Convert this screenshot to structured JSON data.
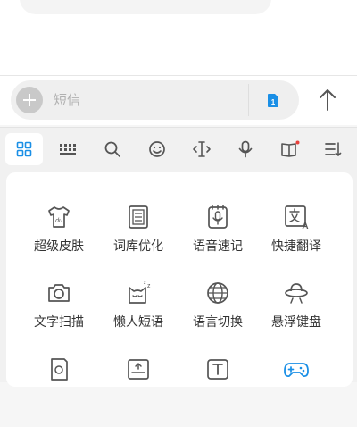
{
  "input_bar": {
    "placeholder": "短信"
  },
  "toolbar": {
    "items": [
      {
        "name": "grid-icon",
        "active": true
      },
      {
        "name": "keyboard-icon",
        "active": false
      },
      {
        "name": "search-icon",
        "active": false
      },
      {
        "name": "emoji-icon",
        "active": false
      },
      {
        "name": "cursor-move-icon",
        "active": false
      },
      {
        "name": "microphone-icon",
        "active": false
      },
      {
        "name": "book-icon",
        "active": false,
        "badge": true
      },
      {
        "name": "menu-icon",
        "active": false
      }
    ]
  },
  "tools": [
    {
      "label": "超级皮肤",
      "icon": "tshirt-icon"
    },
    {
      "label": "词库优化",
      "icon": "dictionary-icon"
    },
    {
      "label": "语音速记",
      "icon": "voice-note-icon"
    },
    {
      "label": "快捷翻译",
      "icon": "translate-icon"
    },
    {
      "label": "文字扫描",
      "icon": "camera-icon"
    },
    {
      "label": "懒人短语",
      "icon": "sleepy-cat-icon"
    },
    {
      "label": "语言切换",
      "icon": "globe-icon"
    },
    {
      "label": "悬浮键盘",
      "icon": "ufo-icon"
    },
    {
      "label": "",
      "icon": "clipboard-icon"
    },
    {
      "label": "",
      "icon": "keyboard-adjust-icon"
    },
    {
      "label": "",
      "icon": "text-box-icon"
    },
    {
      "label": "",
      "icon": "gamepad-icon"
    }
  ],
  "colors": {
    "accent": "#1a8fe6",
    "icon": "#555555",
    "label": "#333333",
    "badge": "#e8413c"
  }
}
